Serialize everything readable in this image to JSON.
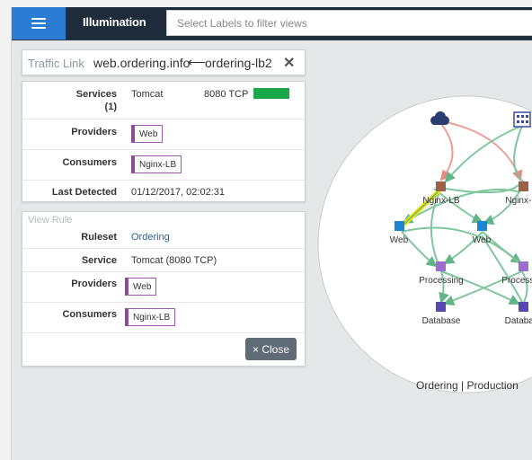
{
  "topbar": {
    "app_title": "Illumination",
    "search_placeholder": "Select Labels to filter views"
  },
  "traffic_link": {
    "label": "Traffic Link",
    "source": "web.ordering.info",
    "arrow": "⟵",
    "target": "ordering-lb2",
    "close": "✕"
  },
  "details": {
    "services_label": "Services",
    "services_count": "(1)",
    "service_name": "Tomcat",
    "service_port": "8080 TCP",
    "providers_label": "Providers",
    "providers_tag": "Web",
    "consumers_label": "Consumers",
    "consumers_tag": "Nginx-LB",
    "last_detected_label": "Last Detected",
    "last_detected_value": "01/12/2017, 02:02:31"
  },
  "view_rule": {
    "title": "View Rule",
    "ruleset_label": "Ruleset",
    "ruleset_value": "Ordering",
    "service_label": "Service",
    "service_value": "Tomcat (8080 TCP)",
    "providers_label": "Providers",
    "providers_tag": "Web",
    "consumers_label": "Consumers",
    "consumers_tag": "Nginx-LB",
    "close_button": "× Close"
  },
  "graph": {
    "nodes": [
      "Nginx-LB",
      "Nginx-LB",
      "Web",
      "Web",
      "Processing",
      "Processing",
      "Database",
      "Database"
    ],
    "caption": "Ordering | Production"
  },
  "colors": {
    "primary": "#2b7cd3",
    "topbar": "#1e2b3a",
    "edge_green": "#7fc69d",
    "edge_red": "#ee9e97",
    "highlight": "#f3e500",
    "tag_purple": "#8d4b9c"
  }
}
